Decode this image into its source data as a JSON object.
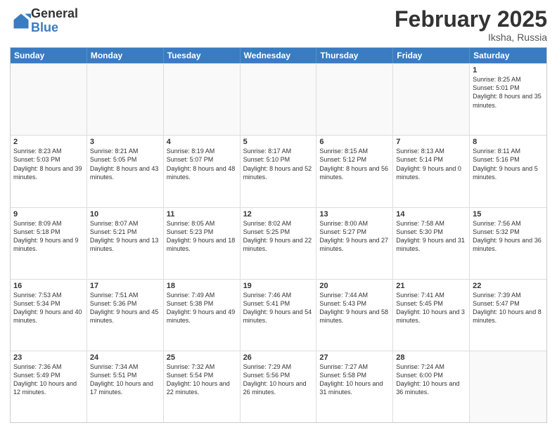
{
  "header": {
    "logo_general": "General",
    "logo_blue": "Blue",
    "month_year": "February 2025",
    "location": "Iksha, Russia"
  },
  "days_of_week": [
    "Sunday",
    "Monday",
    "Tuesday",
    "Wednesday",
    "Thursday",
    "Friday",
    "Saturday"
  ],
  "weeks": [
    [
      {
        "day": "",
        "text": ""
      },
      {
        "day": "",
        "text": ""
      },
      {
        "day": "",
        "text": ""
      },
      {
        "day": "",
        "text": ""
      },
      {
        "day": "",
        "text": ""
      },
      {
        "day": "",
        "text": ""
      },
      {
        "day": "1",
        "text": "Sunrise: 8:25 AM\nSunset: 5:01 PM\nDaylight: 8 hours and 35 minutes."
      }
    ],
    [
      {
        "day": "2",
        "text": "Sunrise: 8:23 AM\nSunset: 5:03 PM\nDaylight: 8 hours and 39 minutes."
      },
      {
        "day": "3",
        "text": "Sunrise: 8:21 AM\nSunset: 5:05 PM\nDaylight: 8 hours and 43 minutes."
      },
      {
        "day": "4",
        "text": "Sunrise: 8:19 AM\nSunset: 5:07 PM\nDaylight: 8 hours and 48 minutes."
      },
      {
        "day": "5",
        "text": "Sunrise: 8:17 AM\nSunset: 5:10 PM\nDaylight: 8 hours and 52 minutes."
      },
      {
        "day": "6",
        "text": "Sunrise: 8:15 AM\nSunset: 5:12 PM\nDaylight: 8 hours and 56 minutes."
      },
      {
        "day": "7",
        "text": "Sunrise: 8:13 AM\nSunset: 5:14 PM\nDaylight: 9 hours and 0 minutes."
      },
      {
        "day": "8",
        "text": "Sunrise: 8:11 AM\nSunset: 5:16 PM\nDaylight: 9 hours and 5 minutes."
      }
    ],
    [
      {
        "day": "9",
        "text": "Sunrise: 8:09 AM\nSunset: 5:18 PM\nDaylight: 9 hours and 9 minutes."
      },
      {
        "day": "10",
        "text": "Sunrise: 8:07 AM\nSunset: 5:21 PM\nDaylight: 9 hours and 13 minutes."
      },
      {
        "day": "11",
        "text": "Sunrise: 8:05 AM\nSunset: 5:23 PM\nDaylight: 9 hours and 18 minutes."
      },
      {
        "day": "12",
        "text": "Sunrise: 8:02 AM\nSunset: 5:25 PM\nDaylight: 9 hours and 22 minutes."
      },
      {
        "day": "13",
        "text": "Sunrise: 8:00 AM\nSunset: 5:27 PM\nDaylight: 9 hours and 27 minutes."
      },
      {
        "day": "14",
        "text": "Sunrise: 7:58 AM\nSunset: 5:30 PM\nDaylight: 9 hours and 31 minutes."
      },
      {
        "day": "15",
        "text": "Sunrise: 7:56 AM\nSunset: 5:32 PM\nDaylight: 9 hours and 36 minutes."
      }
    ],
    [
      {
        "day": "16",
        "text": "Sunrise: 7:53 AM\nSunset: 5:34 PM\nDaylight: 9 hours and 40 minutes."
      },
      {
        "day": "17",
        "text": "Sunrise: 7:51 AM\nSunset: 5:36 PM\nDaylight: 9 hours and 45 minutes."
      },
      {
        "day": "18",
        "text": "Sunrise: 7:49 AM\nSunset: 5:38 PM\nDaylight: 9 hours and 49 minutes."
      },
      {
        "day": "19",
        "text": "Sunrise: 7:46 AM\nSunset: 5:41 PM\nDaylight: 9 hours and 54 minutes."
      },
      {
        "day": "20",
        "text": "Sunrise: 7:44 AM\nSunset: 5:43 PM\nDaylight: 9 hours and 58 minutes."
      },
      {
        "day": "21",
        "text": "Sunrise: 7:41 AM\nSunset: 5:45 PM\nDaylight: 10 hours and 3 minutes."
      },
      {
        "day": "22",
        "text": "Sunrise: 7:39 AM\nSunset: 5:47 PM\nDaylight: 10 hours and 8 minutes."
      }
    ],
    [
      {
        "day": "23",
        "text": "Sunrise: 7:36 AM\nSunset: 5:49 PM\nDaylight: 10 hours and 12 minutes."
      },
      {
        "day": "24",
        "text": "Sunrise: 7:34 AM\nSunset: 5:51 PM\nDaylight: 10 hours and 17 minutes."
      },
      {
        "day": "25",
        "text": "Sunrise: 7:32 AM\nSunset: 5:54 PM\nDaylight: 10 hours and 22 minutes."
      },
      {
        "day": "26",
        "text": "Sunrise: 7:29 AM\nSunset: 5:56 PM\nDaylight: 10 hours and 26 minutes."
      },
      {
        "day": "27",
        "text": "Sunrise: 7:27 AM\nSunset: 5:58 PM\nDaylight: 10 hours and 31 minutes."
      },
      {
        "day": "28",
        "text": "Sunrise: 7:24 AM\nSunset: 6:00 PM\nDaylight: 10 hours and 36 minutes."
      },
      {
        "day": "",
        "text": ""
      }
    ]
  ]
}
